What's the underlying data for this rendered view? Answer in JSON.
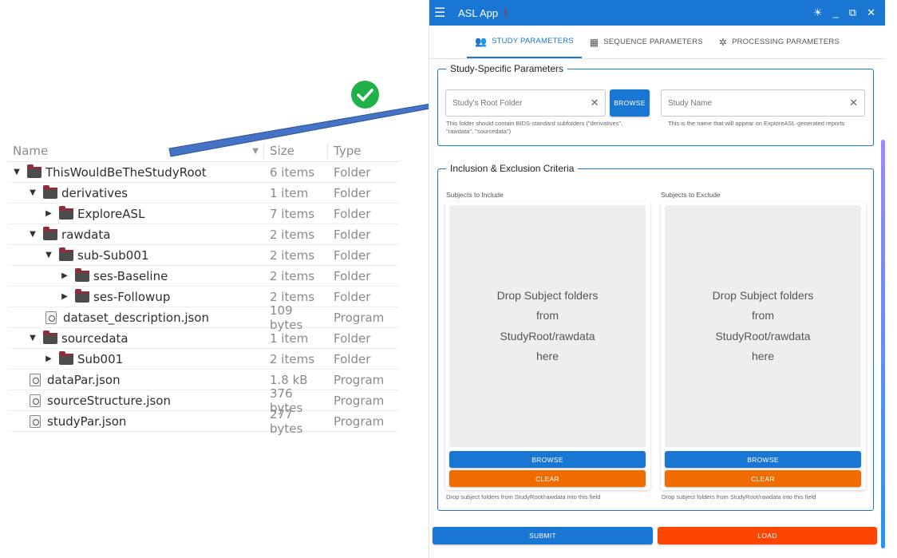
{
  "file_browser": {
    "columns": {
      "name": "Name",
      "size": "Size",
      "type": "Type"
    },
    "rows": [
      {
        "indent": 0,
        "kind": "folder",
        "expander": "expanded",
        "name": "ThisWouldBeTheStudyRoot",
        "size": "6 items",
        "type": "Folder"
      },
      {
        "indent": 1,
        "kind": "folder",
        "expander": "expanded",
        "name": "derivatives",
        "size": "1 item",
        "type": "Folder"
      },
      {
        "indent": 2,
        "kind": "folder",
        "expander": "collapsed",
        "name": "ExploreASL",
        "size": "7 items",
        "type": "Folder"
      },
      {
        "indent": 1,
        "kind": "folder",
        "expander": "expanded",
        "name": "rawdata",
        "size": "2 items",
        "type": "Folder"
      },
      {
        "indent": 2,
        "kind": "folder",
        "expander": "expanded",
        "name": "sub-Sub001",
        "size": "2 items",
        "type": "Folder"
      },
      {
        "indent": 3,
        "kind": "folder",
        "expander": "collapsed",
        "name": "ses-Baseline",
        "size": "2 items",
        "type": "Folder"
      },
      {
        "indent": 3,
        "kind": "folder",
        "expander": "collapsed",
        "name": "ses-Followup",
        "size": "2 items",
        "type": "Folder"
      },
      {
        "indent": 2,
        "kind": "file",
        "expander": "none",
        "name": "dataset_description.json",
        "size": "109 bytes",
        "type": "Program"
      },
      {
        "indent": 1,
        "kind": "folder",
        "expander": "expanded",
        "name": "sourcedata",
        "size": "1 item",
        "type": "Folder"
      },
      {
        "indent": 2,
        "kind": "folder",
        "expander": "collapsed",
        "name": "Sub001",
        "size": "2 items",
        "type": "Folder"
      },
      {
        "indent": 1,
        "kind": "file",
        "expander": "none",
        "name": "dataPar.json",
        "size": "1.8 kB",
        "type": "Program"
      },
      {
        "indent": 1,
        "kind": "file",
        "expander": "none",
        "name": "sourceStructure.json",
        "size": "376 bytes",
        "type": "Program"
      },
      {
        "indent": 1,
        "kind": "file",
        "expander": "none",
        "name": "studyPar.json",
        "size": "277 bytes",
        "type": "Program"
      }
    ]
  },
  "annotation": {
    "arrow_color": "#4472c4",
    "check_color": "#22b04b",
    "check_icon": "checkmark-icon"
  },
  "app": {
    "title": "ASL App",
    "accent_color": "#1976d2",
    "tabs": [
      {
        "label": "STUDY PARAMETERS",
        "icon": "people-icon",
        "active": true
      },
      {
        "label": "SEQUENCE PARAMETERS",
        "icon": "grid-icon",
        "active": false
      },
      {
        "label": "PROCESSING PARAMETERS",
        "icon": "cog-ring-icon",
        "active": false
      }
    ],
    "study_params": {
      "legend": "Study-Specific Parameters",
      "root_folder": {
        "placeholder": "Study's Root Folder",
        "value": "",
        "helper": "This folder should contain BIDS-standard subfolders (\"derivatives\", \"rawdata\", \"sourcedata\")"
      },
      "browse_label": "BROWSE",
      "study_name": {
        "placeholder": "Study Name",
        "value": "",
        "helper": "This is the name that will appear on ExploreASL-generated reports"
      }
    },
    "criteria": {
      "legend": "Inclusion & Exclusion Criteria",
      "include": {
        "label": "Subjects to Include",
        "drop_text": "Drop Subject folders from StudyRoot/rawdata here",
        "browse_label": "BROWSE",
        "clear_label": "CLEAR",
        "helper": "Drop subject folders from StudyRoot/rawdata into this field"
      },
      "exclude": {
        "label": "Subjects to Exclude",
        "drop_text": "Drop Subject folders from StudyRoot/rawdata here",
        "browse_label": "BROWSE",
        "clear_label": "CLEAR",
        "helper": "Drop subject folders from StudyRoot/rawdata into this field"
      }
    },
    "submit_label": "SUBMIT",
    "load_label": "LOAD"
  }
}
